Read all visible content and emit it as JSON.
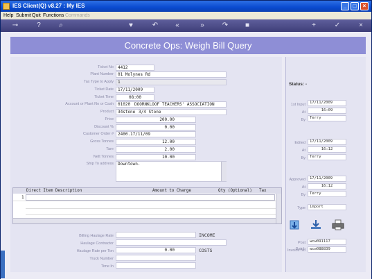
{
  "window": {
    "title": "IES Client(Q) v8.27 : My IES"
  },
  "menu": {
    "items": [
      "Help",
      "Submit",
      "Quit",
      "Functions",
      "Commands"
    ]
  },
  "toolbar": {
    "icons": [
      "key-icon",
      "help-icon",
      "search-icon",
      "heart-icon",
      "undo-icon",
      "rewind-icon",
      "fast-forward-icon",
      "redo-icon",
      "stop-icon",
      "add-icon",
      "check-icon",
      "close-icon"
    ]
  },
  "page": {
    "title": "Concrete Ops: Weigh Bill Query"
  },
  "form": {
    "ticket_no_label": "Ticket No",
    "ticket_no": "4412",
    "plant_number_label": "Plant Number",
    "plant_number": "01 Molynes Rd",
    "tax_type_label": "Tax Type to Apply",
    "tax_type": "1",
    "ticket_date_label": "Ticket Date",
    "ticket_date": "17/11/2009",
    "ticket_time_label": "Ticket Time",
    "ticket_time": "08:00",
    "account_label": "Account or Plant No or Cash",
    "account_no": "01020",
    "account_name": "DOORNKLOOF TEACHERS' ASSOCIATION",
    "product_label": "Product",
    "product_code": "34stone",
    "product_name": "3/4 Stone",
    "price_label": "Price",
    "price": "200.00",
    "discount_label": "Discount %",
    "discount": "0.00",
    "customer_order_label": "Customer Order #",
    "customer_order": "2400.17/11/09",
    "gross_label": "Gross Tonnes",
    "gross": "12.00",
    "tare_label": "Tare",
    "tare": "2.00",
    "nett_label": "Nett Tonnes",
    "nett": "10.00",
    "ship_to_label": "Ship To address",
    "ship_to": "Downtown."
  },
  "grid": {
    "columns": [
      "Direct Item Description",
      "Amount to Charge",
      "Qty (Optional)",
      "Tax"
    ],
    "row_number": "1"
  },
  "haulage": {
    "billing_rate_label": "Billing Haulage Rate",
    "income_label": "INCOME",
    "contractor_label": "Haulage Contractor",
    "rate_per_ton_label": "Haulage Rate per Ton",
    "rate_per_ton": "0.00",
    "costs_label": "COSTS",
    "truck_label": "Truck Number",
    "time_in_label": "Time In"
  },
  "status": {
    "status_label": "Status: -",
    "first_input_label": "1st Input",
    "first_input_date": "17/11/2009",
    "at_label": "At",
    "first_input_time": "16:09",
    "by_label": "By",
    "first_input_by": "Terry",
    "edited_label": "Edited",
    "edited_date": "17/11/2009",
    "edited_time": "16:12",
    "edited_by": "Terry",
    "approved_label": "Approved",
    "approved_date": "17/11/2009",
    "approved_time": "16:12",
    "approved_by": "Terry",
    "type_label": "Type",
    "type": "import",
    "post_batch_label": "Post Batch",
    "post_batch": "wcw091117",
    "invoice_no_label": "Invoice No",
    "invoice_no": "wcw088839"
  }
}
